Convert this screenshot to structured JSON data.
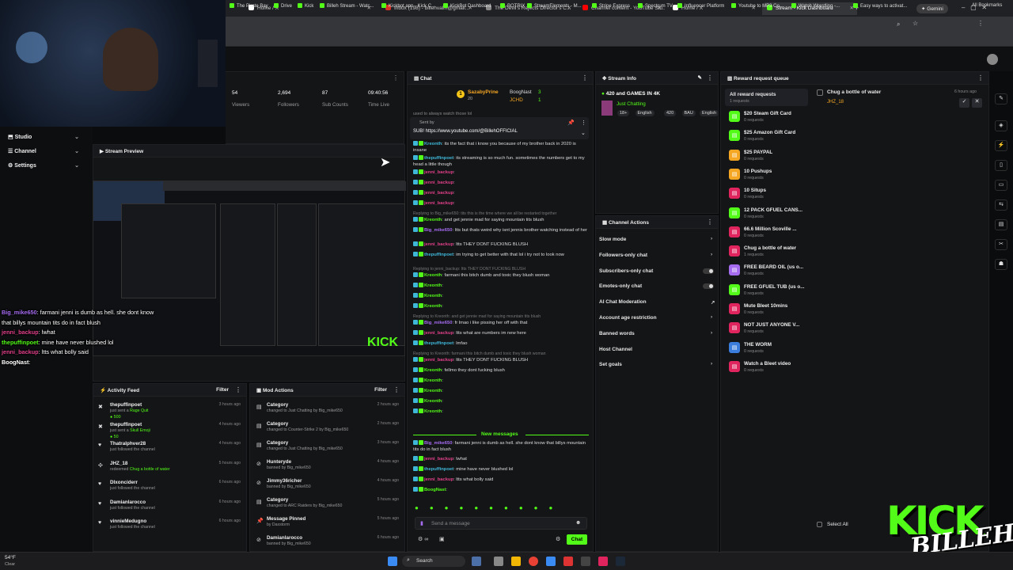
{
  "browser": {
    "tabs": [
      {
        "label": "",
        "color": "#aaa"
      },
      {
        "label": "Home / X",
        "color": "#fff"
      },
      {
        "label": "Inbox (198) - billehvalm@gmail...",
        "color": "#d93025"
      },
      {
        "label": "The Devil's Rejects Director's C...",
        "color": "#888"
      },
      {
        "label": "Channel content - YouTube Stu...",
        "color": "#ff0000"
      },
      {
        "label": "Home / X",
        "color": "#fff"
      },
      {
        "label": "Stream - Kick Dashboard",
        "color": "#53fc18"
      }
    ],
    "gemini_label": "Gemini",
    "bookmarks": [
      "The Pirate Bay",
      "Drive",
      "Kick",
      "Billeh Stream - Watc...",
      "Kickbot.app - Kick C...",
      "KickBot Dashboard",
      "BOTRIX",
      "StreamElements - M...",
      "Stripe Express",
      "Spectrum TV",
      "Influencer Platform",
      "Youtube to MP3 Co...",
      "Watch Wrestling -...",
      "Easy ways to activat..."
    ],
    "all_bookmarks": "All Bookmarks"
  },
  "stats": [
    {
      "value": "54",
      "label": "Viewers"
    },
    {
      "value": "2,694",
      "label": "Followers"
    },
    {
      "value": "87",
      "label": "Sub Counts"
    },
    {
      "value": "09:40:56",
      "label": "Time Live"
    }
  ],
  "sidebar": {
    "items": [
      {
        "label": "Studio",
        "icon": "studio-icon"
      },
      {
        "label": "Channel",
        "icon": "channel-icon"
      },
      {
        "label": "Settings",
        "icon": "gear-icon"
      }
    ]
  },
  "stream_preview": {
    "title": "Stream Preview"
  },
  "overlay_chat": [
    {
      "user": "Big_mike650",
      "text": ": farmani jenni is dumb as hell. she dont know"
    },
    {
      "user": "",
      "text": "that billys mountain tits do in fact blush"
    },
    {
      "user": "jenni_backup",
      "text": ": lwhat"
    },
    {
      "user": "thepuffinpoet",
      "text": ": mine have never blushed lol"
    },
    {
      "user": "jenni_backup",
      "text": ": ltts what bolly said"
    },
    {
      "user": "BoogNast",
      "text": ":"
    }
  ],
  "chat": {
    "title": "Chat",
    "top_user": "SazabyPrine",
    "top_user_sub": "20",
    "top_user2": "BoogNast",
    "top_user2_count": "3",
    "top_user3": "JCHD",
    "top_user3_count": "1",
    "pinned_partial": "used to always watch those lol",
    "pinned_by": "Sent by",
    "pinned_msg": "SUB! https://www.youtube.com/@BillehOFFICIAL",
    "messages": [
      {
        "user": "Kreonth",
        "color": "#3fb8d8",
        "text": ": its the fact that i know you because of my brother back in 2020 is insane"
      },
      {
        "user": "thepuffinpoet",
        "color": "#3fb8d8",
        "text": ": its streaming is so much fun. sometimes the numbers get to my head a little though"
      },
      {
        "user": "jenni_backup",
        "color": "#e0408a",
        "text": ":"
      },
      {
        "user": "jenni_backup",
        "color": "#e0408a",
        "text": ":"
      },
      {
        "user": "jenni_backup",
        "color": "#e0408a",
        "text": ":"
      },
      {
        "user": "jenni_backup",
        "color": "#e0408a",
        "text": ":"
      },
      {
        "user": "Kreonth",
        "color": "#53fc18",
        "text": ": and get jennie mad for saying mountain tits blush",
        "reply": "Replying to Big_mike650: tits this is the time where we all be restarted together"
      },
      {
        "user": "Big_mike650",
        "color": "#a56cf0",
        "text": ": ltts but thats weird why isnt jennis brother watching instead of her"
      },
      {
        "user": "jenni_backup",
        "color": "#e0408a",
        "text": ": ltts THEY DONT FUCKING BLUSH"
      },
      {
        "user": "thepuffinpoet",
        "color": "#3fb8d8",
        "text": ": im trying to get better with that lol i try not to look now"
      },
      {
        "user": "Kreonth",
        "color": "#53fc18",
        "text": ": farmani this bitch dumb and toxic they blush woman",
        "reply": "Replying to jenni_backup: ltts THEY DONT FUCKING BLUSH"
      },
      {
        "user": "Kreonth",
        "color": "#53fc18",
        "text": ":"
      },
      {
        "user": "Kreonth",
        "color": "#53fc18",
        "text": ":"
      },
      {
        "user": "Kreonth",
        "color": "#53fc18",
        "text": ":"
      },
      {
        "user": "Big_mike650",
        "color": "#a56cf0",
        "text": ": fr lmao i like pissing her off with that",
        "reply": "Replying to Kreonth: and get jennie mad for saying mountain tits blush"
      },
      {
        "user": "jenni_backup",
        "color": "#e0408a",
        "text": ": ltts what are numbers im new here"
      },
      {
        "user": "thepuffinpoet",
        "color": "#3fb8d8",
        "text": ": lmfao"
      },
      {
        "user": "jenni_backup",
        "color": "#e0408a",
        "text": ": ltts THEY DONT FUCKING BLUSH",
        "reply": "Replying to Kreonth: farmani this bitch dumb and toxic they blush woman"
      },
      {
        "user": "Kreonth",
        "color": "#53fc18",
        "text": ": fellmo they dont fucking blush"
      },
      {
        "user": "Kreonth",
        "color": "#53fc18",
        "text": ":"
      },
      {
        "user": "Kreonth",
        "color": "#53fc18",
        "text": ":"
      },
      {
        "user": "Kreonth",
        "color": "#53fc18",
        "text": ":"
      },
      {
        "user": "Kreonth",
        "color": "#53fc18",
        "text": ":"
      }
    ],
    "new_messages_label": "New messages",
    "new_messages": [
      {
        "user": "Big_mike650",
        "color": "#a56cf0",
        "text": ": farmani jenni is dumb as hell. she dont know that billys mountain tits do in fact blush"
      },
      {
        "user": "jenni_backup",
        "color": "#e0408a",
        "text": ": lwhat"
      },
      {
        "user": "thepuffinpoet",
        "color": "#3fb8d8",
        "text": ": mine have never blushed lol"
      },
      {
        "user": "jenni_backup",
        "color": "#e0408a",
        "text": ": ltts what bolly said"
      },
      {
        "user": "BoogNast",
        "color": "#53fc18",
        "text": ":"
      }
    ],
    "input_placeholder": "Send a message",
    "send_label": "Chat"
  },
  "stream_info": {
    "title": "Stream Info",
    "stream_title": "420 and GAMES IN 4K",
    "category": "Just Chatting",
    "tags": [
      "18+",
      "English",
      "420",
      "BAU",
      "English"
    ]
  },
  "channel_actions": {
    "title": "Channel Actions",
    "items": [
      {
        "label": "Slow mode",
        "control": "chevron"
      },
      {
        "label": "Followers-only chat",
        "control": "chevron"
      },
      {
        "label": "Subscribers-only chat",
        "control": "toggle"
      },
      {
        "label": "Emotes-only chat",
        "control": "toggle"
      },
      {
        "label": "AI Chat Moderation",
        "control": "external"
      },
      {
        "label": "Account age restriction",
        "control": "chevron"
      },
      {
        "label": "Banned words",
        "control": "chevron"
      },
      {
        "label": "Host Channel",
        "control": "none"
      },
      {
        "label": "Set goals",
        "control": "chevron"
      }
    ]
  },
  "reward_queue": {
    "title": "Reward request queue",
    "all_label": "All reward requests",
    "all_count": "1 requests",
    "pending_item": "Chug a bottle of water",
    "pending_user": "JHZ_18",
    "pending_time": "6 hours ago",
    "select_all": "Select All",
    "rewards": [
      {
        "title": "$20 Steam Gift Card",
        "count": "0 requests",
        "color": "#53fc18"
      },
      {
        "title": "$25 Amazon Gift Card",
        "count": "0 requests",
        "color": "#53fc18"
      },
      {
        "title": "$25 PAYPAL",
        "count": "0 requests",
        "color": "#f5a623"
      },
      {
        "title": "10 Pushups",
        "count": "0 requests",
        "color": "#f5a623"
      },
      {
        "title": "10 Situps",
        "count": "0 requests",
        "color": "#e0245e"
      },
      {
        "title": "12 PACK GFUEL CANS...",
        "count": "0 requests",
        "color": "#53fc18"
      },
      {
        "title": "66.6 Million Scoville ...",
        "count": "0 requests",
        "color": "#e0245e"
      },
      {
        "title": "Chug a bottle of water",
        "count": "1 requests",
        "color": "#e0245e"
      },
      {
        "title": "FREE BEARD OIL (us o...",
        "count": "0 requests",
        "color": "#a56cf0"
      },
      {
        "title": "FREE GFUEL TUB (us o...",
        "count": "0 requests",
        "color": "#53fc18"
      },
      {
        "title": "Mute Bleet 10mins",
        "count": "0 requests",
        "color": "#e0245e"
      },
      {
        "title": "NOT JUST ANYONE V...",
        "count": "0 requests",
        "color": "#e0245e"
      },
      {
        "title": "THE WORM",
        "count": "0 requests",
        "color": "#3b7ddd"
      },
      {
        "title": "Watch a Bleet video",
        "count": "0 requests",
        "color": "#e0245e"
      }
    ]
  },
  "activity_feed": {
    "title": "Activity Feed",
    "filter_label": "Filter",
    "items": [
      {
        "user": "thepuffinpoet",
        "action": "just sent a",
        "target": "Rage Quit",
        "extra": "500",
        "time": "3 hours ago",
        "icon": "kick-icon"
      },
      {
        "user": "thepuffinpoet",
        "action": "just sent a",
        "target": "Skull Emoji",
        "extra": "50",
        "time": "4 hours ago",
        "icon": "kick-icon"
      },
      {
        "user": "Thatralphver28",
        "action": "just followed the channel",
        "target": "",
        "extra": "",
        "time": "4 hours ago",
        "icon": "heart-icon"
      },
      {
        "user": "JHZ_18",
        "action": "redeemed",
        "target": "Chug a bottle of water",
        "extra": "",
        "time": "5 hours ago",
        "icon": "reward-icon"
      },
      {
        "user": "Dlxonciderr",
        "action": "just followed the channel",
        "target": "",
        "extra": "",
        "time": "6 hours ago",
        "icon": "heart-icon"
      },
      {
        "user": "Damianlarocco",
        "action": "just followed the channel",
        "target": "",
        "extra": "",
        "time": "6 hours ago",
        "icon": "heart-icon"
      },
      {
        "user": "vinnieMedugno",
        "action": "just followed the channel",
        "target": "",
        "extra": "",
        "time": "6 hours ago",
        "icon": "heart-icon"
      }
    ]
  },
  "mod_actions": {
    "title": "Mod Actions",
    "filter_label": "Filter",
    "items": [
      {
        "title": "Category",
        "line": "changed to Just Chatting by Big_mike650",
        "time": "2 hours ago",
        "icon": "category-icon"
      },
      {
        "title": "Category",
        "line": "changed to Counter-Strike 2 by Big_mike650",
        "time": "2 hours ago",
        "icon": "category-icon"
      },
      {
        "title": "Category",
        "line": "changed to Just Chatting by Big_mike650",
        "time": "3 hours ago",
        "icon": "category-icon"
      },
      {
        "title": "Hunteryde",
        "line": "banned by Big_mike650",
        "time": "4 hours ago",
        "icon": "ban-icon"
      },
      {
        "title": "Jimmy36richer",
        "line": "banned by Big_mike650",
        "time": "4 hours ago",
        "icon": "ban-icon"
      },
      {
        "title": "Category",
        "line": "changed to ARC Raiders by Big_mike650",
        "time": "5 hours ago",
        "icon": "category-icon"
      },
      {
        "title": "Message Pinned",
        "line": "by Daxstorm",
        "time": "5 hours ago",
        "icon": "pin-icon"
      },
      {
        "title": "Damianlarocco",
        "line": "banned by Big_mike650",
        "time": "6 hours ago",
        "icon": "ban-icon"
      }
    ]
  },
  "taskbar": {
    "weather_temp": "54°F",
    "weather_desc": "Clear",
    "search_placeholder": "Search"
  },
  "branding": {
    "logo_text": "KICK",
    "logo_sub": "BILLEH"
  },
  "colors": {
    "accent": "#53fc18",
    "panel": "#141517"
  }
}
